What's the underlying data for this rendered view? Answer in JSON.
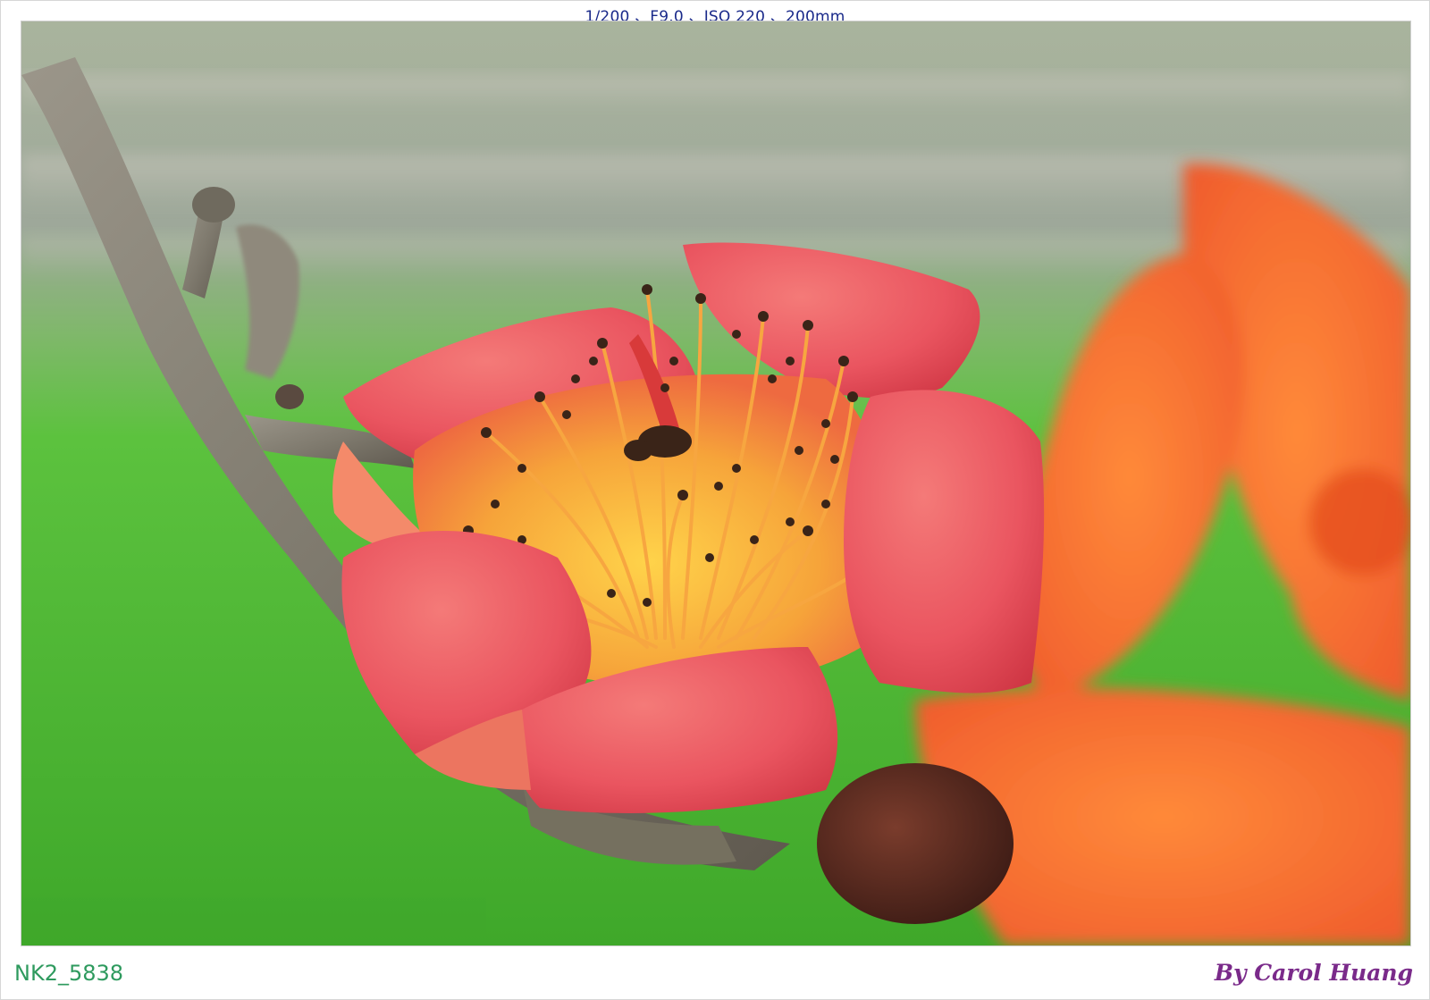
{
  "header": {
    "exif": "1/200 、F9.0 、ISO 220 、200mm"
  },
  "footer": {
    "file_name": "NK2_5838",
    "signature": "By Carol Huang"
  },
  "colors": {
    "exif_text": "#1a2a8a",
    "file_name_text": "#2e9a5e",
    "signature_text": "#7a2a8a",
    "background_green": "#52c43a",
    "petal_red": "#e8505a",
    "petal_orange": "#f2602a",
    "stamen_yellow": "#f6c040",
    "anther_dark": "#3a2418",
    "branch_gray": "#8a857a"
  },
  "photo": {
    "subject": "red silk cotton flower",
    "has_signature": true
  }
}
